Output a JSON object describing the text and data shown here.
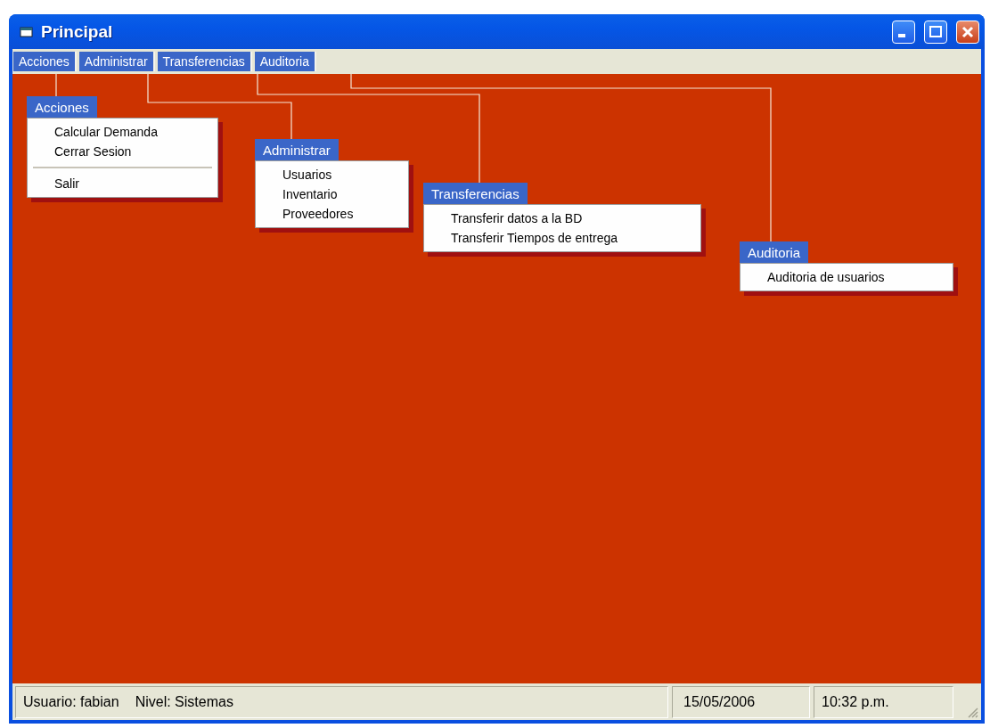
{
  "window": {
    "title": "Principal"
  },
  "menu_bar": [
    {
      "label": "Acciones",
      "selected": true
    },
    {
      "label": "Administrar",
      "selected": true
    },
    {
      "label": "Transferencias",
      "selected": true
    },
    {
      "label": "Auditoria",
      "selected": true
    }
  ],
  "menus": [
    {
      "title": "Acciones",
      "items": [
        {
          "kind": "item",
          "label": "Calcular Demanda"
        },
        {
          "kind": "item",
          "label": "Cerrar Sesion"
        },
        {
          "kind": "separator"
        },
        {
          "kind": "item",
          "label": "Salir"
        }
      ]
    },
    {
      "title": "Administrar",
      "items": [
        {
          "kind": "item",
          "label": "Usuarios"
        },
        {
          "kind": "item",
          "label": "Inventario"
        },
        {
          "kind": "item",
          "label": "Proveedores"
        }
      ]
    },
    {
      "title": "Transferencias",
      "items": [
        {
          "kind": "item",
          "label": "Transferir datos a la BD"
        },
        {
          "kind": "item",
          "label": "Transferir Tiempos de entrega"
        }
      ]
    },
    {
      "title": "Auditoria",
      "items": [
        {
          "kind": "item",
          "label": "Auditoria de usuarios"
        }
      ]
    }
  ],
  "status_bar": {
    "user": "Usuario: fabian",
    "role": "Nivel: Sistemas",
    "date": "15/05/2006",
    "time": "10:32 p.m."
  }
}
